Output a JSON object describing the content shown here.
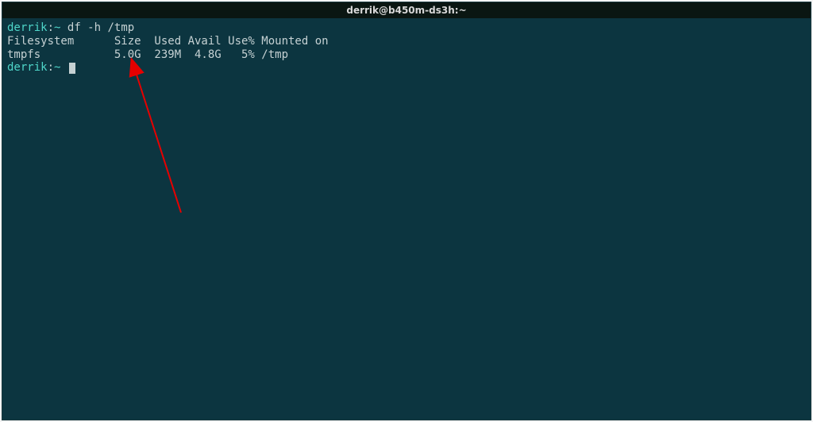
{
  "window": {
    "title": "derrik@b450m-ds3h:~"
  },
  "terminal": {
    "prompt": {
      "user": "derrik",
      "sep1": ":",
      "path": "~",
      "sep2": " "
    },
    "lines": {
      "cmd1": "df -h /tmp",
      "header": "Filesystem      Size  Used Avail Use% Mounted on",
      "row": "tmpfs           5.0G  239M  4.8G   5% /tmp"
    }
  },
  "annotation": {
    "arrow_color": "#e60000"
  },
  "chart_data": {
    "type": "table",
    "title": "df -h /tmp",
    "columns": [
      "Filesystem",
      "Size",
      "Used",
      "Avail",
      "Use%",
      "Mounted on"
    ],
    "rows": [
      {
        "Filesystem": "tmpfs",
        "Size": "5.0G",
        "Used": "239M",
        "Avail": "4.8G",
        "Use%": "5%",
        "Mounted on": "/tmp"
      }
    ]
  }
}
